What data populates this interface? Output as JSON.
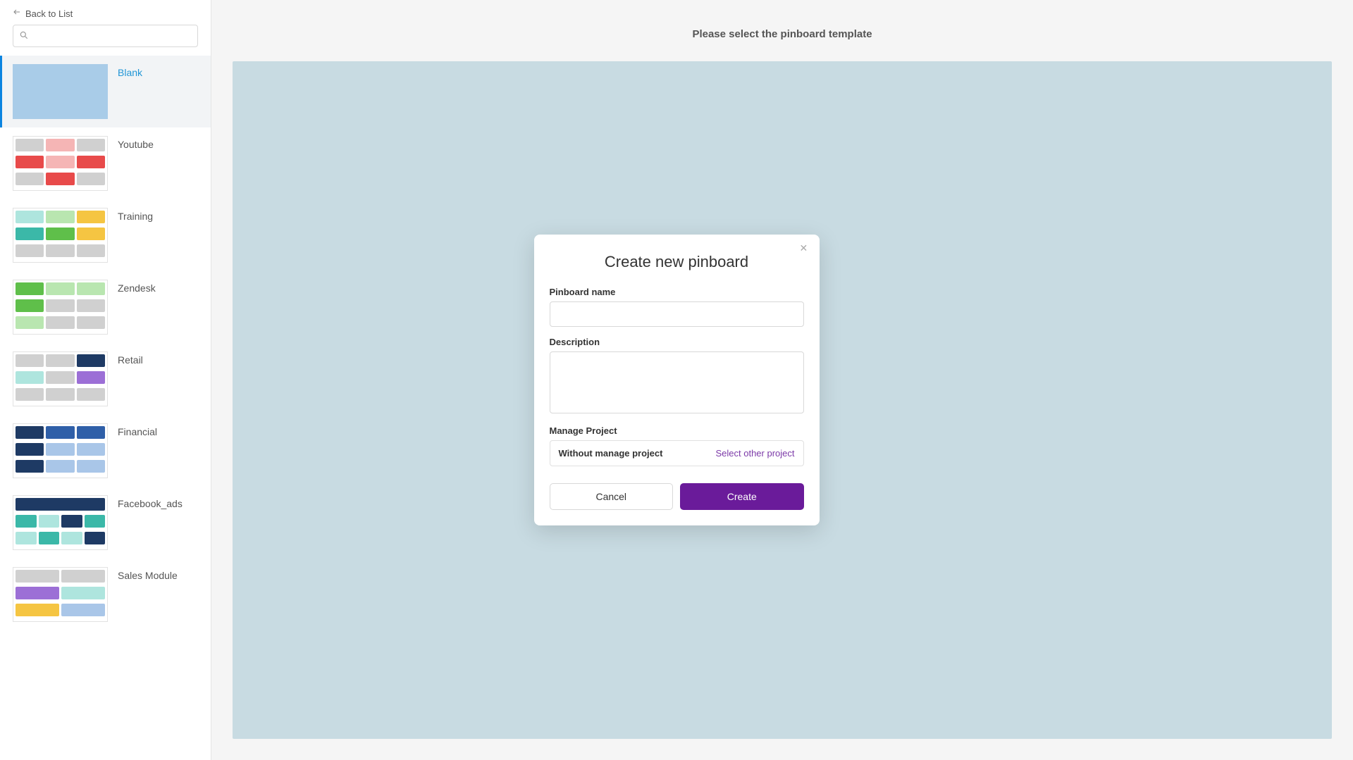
{
  "sidebar": {
    "back_label": "Back to List",
    "search_placeholder": "",
    "templates": [
      {
        "label": "Blank"
      },
      {
        "label": "Youtube"
      },
      {
        "label": "Training"
      },
      {
        "label": "Zendesk"
      },
      {
        "label": "Retail"
      },
      {
        "label": "Financial"
      },
      {
        "label": "Facebook_ads"
      },
      {
        "label": "Sales Module"
      }
    ]
  },
  "main": {
    "header": "Please select the pinboard template"
  },
  "modal": {
    "title": "Create new pinboard",
    "name_label": "Pinboard name",
    "name_value": "",
    "description_label": "Description",
    "description_value": "",
    "manage_project_label": "Manage Project",
    "project_value": "Without manage project",
    "select_other_label": "Select other project",
    "cancel_label": "Cancel",
    "create_label": "Create"
  }
}
